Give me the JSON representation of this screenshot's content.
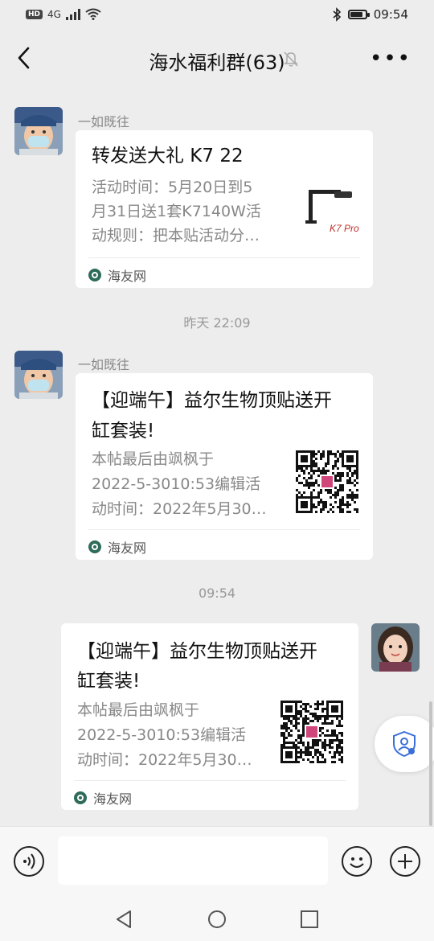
{
  "status_bar": {
    "network": "4G",
    "time": "09:54",
    "battery_level": 0.85
  },
  "chat": {
    "title": "海水福利群(63)",
    "icons": {
      "back": "back-icon",
      "mute": "mute-bell-icon",
      "more": "more-icon"
    }
  },
  "messages": [
    {
      "sender": "一如既往",
      "card": {
        "title": "转发送大礼 K7 22",
        "desc_lines": [
          "活动时间：5月20日到5",
          "月31日送1套K7140W活",
          "动规则：把本贴活动分…"
        ],
        "source": "海友网",
        "thumb_icon": "aquarium-lamp-icon",
        "thumb_caption": "K7 Pro"
      }
    },
    {
      "timestamp": "昨天 22:09"
    },
    {
      "sender": "一如既往",
      "card": {
        "title_lines": [
          "【迎端午】益尔生物顶贴送开",
          "缸套装!"
        ],
        "desc_lines": [
          "本帖最后由飒枫于",
          "2022-5-3010:53编辑活",
          "动时间：2022年5月30…"
        ],
        "source": "海友网",
        "thumb_icon": "qr-code-icon"
      }
    },
    {
      "timestamp": "09:54"
    },
    {
      "sender": "me",
      "card": {
        "title_lines": [
          "【迎端午】益尔生物顶贴送开",
          "缸套装!"
        ],
        "desc_lines": [
          "本帖最后由飒枫于",
          "2022-5-3010:53编辑活",
          "动时间：2022年5月30…"
        ],
        "source": "海友网",
        "thumb_icon": "qr-code-icon"
      }
    }
  ],
  "input_bar": {
    "placeholder": "",
    "icons": {
      "voice": "voice-icon",
      "emoji": "emoji-icon",
      "plus": "plus-icon"
    }
  },
  "colors": {
    "background": "#ededed",
    "card": "#ffffff",
    "muted_text": "#888888",
    "source_icon": "#2e6b5a"
  }
}
